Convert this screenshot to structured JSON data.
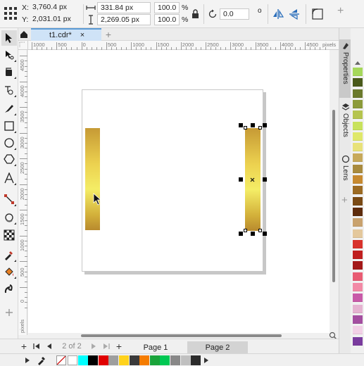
{
  "propbar": {
    "x_label": "X:",
    "x_value": "3,760.4 px",
    "y_label": "Y:",
    "y_value": "2,031.01 px",
    "width_value": "331.84 px",
    "height_value": "2,269.05 px",
    "scale_x": "100.0",
    "scale_y": "100.0",
    "percent": "%",
    "rotation": "0.0",
    "degree": "o",
    "add": "+"
  },
  "tabs": {
    "document": "t1.cdr*",
    "close": "×",
    "add": "+"
  },
  "ruler": {
    "top_labels": [
      "1000",
      "500",
      "0",
      "500",
      "1000",
      "1500",
      "2000",
      "2500",
      "3000",
      "3500",
      "4000",
      "4500"
    ],
    "units": "pixels",
    "left_labels": [
      "4500",
      "4000",
      "3500",
      "3000",
      "2500",
      "2000",
      "1500",
      "1000",
      "500",
      "0"
    ],
    "left_units": "pixels"
  },
  "docker": {
    "tabs": [
      "Properties",
      "Objects",
      "Lens"
    ],
    "add": "+"
  },
  "pagenav": {
    "add_before": "+",
    "page_status": "2 of 2",
    "add_after": "+",
    "pages": [
      "Page 1",
      "Page 2"
    ]
  },
  "colors": {
    "accent": "#5b9bd5",
    "tab_bg": "#cfe3f7",
    "palette": [
      "#a6d85b",
      "#4a5a1b",
      "#6b7a2c",
      "#8c9b3a",
      "#b5c44e",
      "#c8e25c",
      "#dfe86a",
      "#e8e27a",
      "#c7a95a",
      "#a98b3e",
      "#c78a30",
      "#9c6b23",
      "#7a4a14",
      "#5e2c0c",
      "#c9a26e",
      "#e4c89c",
      "#d8322b",
      "#c01f1f",
      "#a31818",
      "#e85c73",
      "#f28aa6",
      "#c85aa8",
      "#e5b3d1",
      "#a44ea0",
      "#f2d0e6",
      "#7a3c9e"
    ],
    "bottom": [
      "#ffffff",
      "#00ffff",
      "#000000",
      "#e00000",
      "#9e9e9e",
      "#ffd21c",
      "#3a3a3a",
      "#f57c00",
      "#1aa33a",
      "#00c853",
      "#888888",
      "#c0c0c0",
      "#2b2b2b"
    ]
  },
  "icons": {
    "toolbox": [
      "pointer-icon",
      "shape-icon",
      "crop-icon",
      "zoom-icon",
      "freehand-icon",
      "rectangle-icon",
      "ellipse-icon",
      "polygon-icon",
      "text-icon",
      "connector-icon",
      "shadow-icon",
      "transparency-icon",
      "eyedropper-icon",
      "fill-icon",
      "smart-fill-icon",
      "add-icon"
    ]
  }
}
